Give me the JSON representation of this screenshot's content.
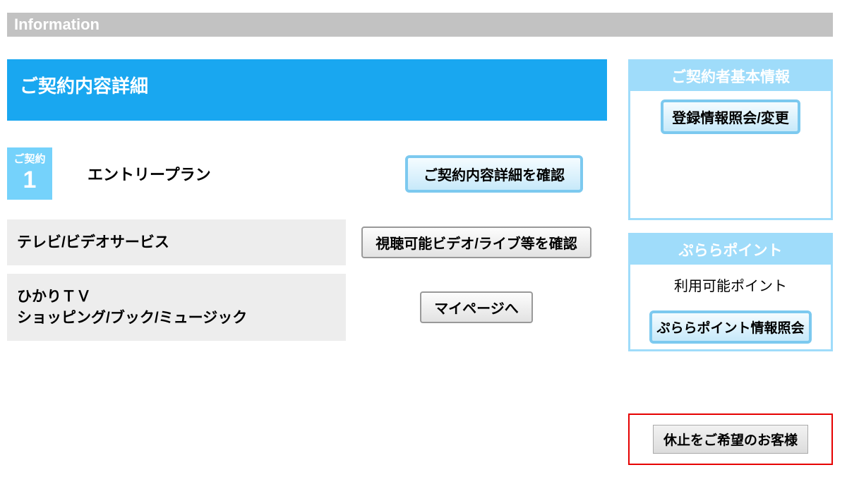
{
  "info_bar": "Information",
  "main": {
    "contract_title": "ご契約内容詳細",
    "badge_small": "ご契約",
    "badge_num": "1",
    "plan_name": "エントリープラン",
    "plan_detail_btn": "ご契約内容詳細を確認",
    "rows": [
      {
        "label": "テレビ/ビデオサービス",
        "btn": "視聴可能ビデオ/ライブ等を確認"
      },
      {
        "label": "ひかりＴＶ\nショッピング/ブック/ミュージック",
        "btn": "マイページへ"
      }
    ]
  },
  "side": {
    "box1_head": "ご契約者基本情報",
    "box1_btn": "登録情報照会/変更",
    "box2_head": "ぷららポイント",
    "box2_text": "利用可能ポイント",
    "box2_btn": "ぷららポイント情報照会"
  },
  "suspend_btn": "休止をご希望のお客様"
}
